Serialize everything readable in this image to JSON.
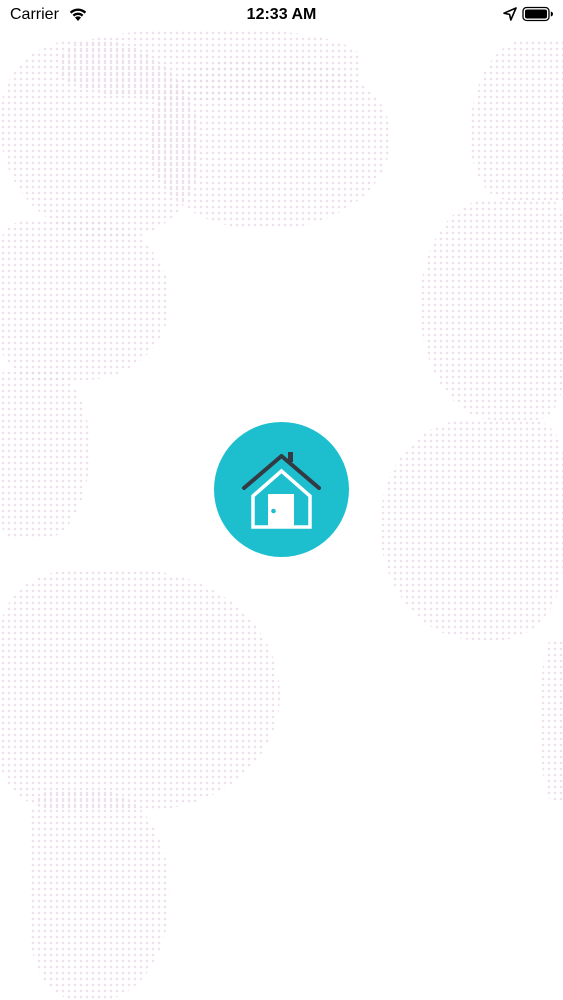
{
  "status_bar": {
    "carrier": "Carrier",
    "time": "12:33 AM",
    "wifi_icon": "wifi-icon",
    "location_icon": "location-arrow-icon",
    "battery_icon": "battery-full-icon"
  },
  "splash": {
    "logo_icon": "house-icon",
    "logo_color": "#1dbfcf",
    "roof_color": "#333a44"
  },
  "background": {
    "style": "dotted world map",
    "dot_color": "#e8d7e6"
  }
}
